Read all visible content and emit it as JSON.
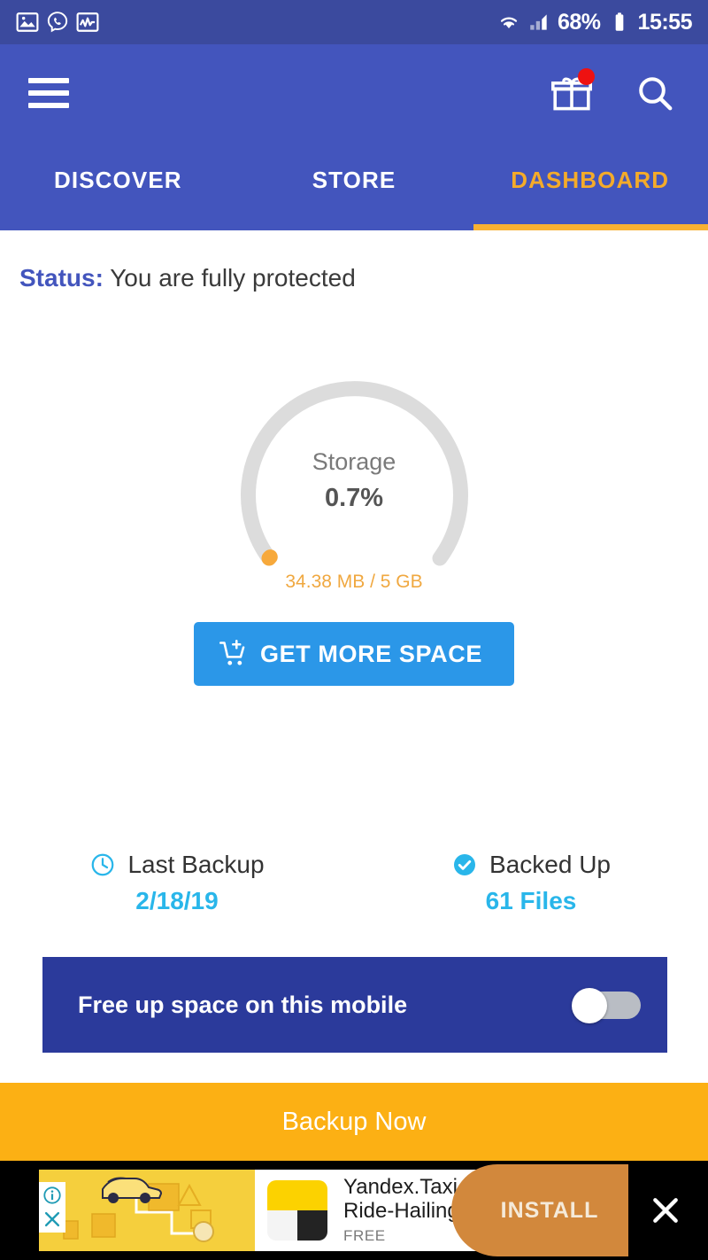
{
  "statusbar": {
    "icons_left": [
      "gallery-icon",
      "viber-call-icon",
      "activity-monitor-icon"
    ],
    "wifi_icon": "wifi-icon",
    "signal_icon": "cell-signal-icon",
    "battery_percent": "68%",
    "battery_icon": "battery-icon",
    "time": "15:55"
  },
  "appbar": {
    "menu_icon": "hamburger-menu-icon",
    "gift_icon": "gift-icon",
    "gift_badge": "",
    "search_icon": "search-icon",
    "tabs": [
      {
        "label": "DISCOVER",
        "active": false
      },
      {
        "label": "STORE",
        "active": false
      },
      {
        "label": "DASHBOARD",
        "active": true
      }
    ]
  },
  "status": {
    "label": "Status:",
    "value": "You are fully protected"
  },
  "gauge": {
    "title": "Storage",
    "percent_label": "0.7%",
    "usage_label": "34.38 MB / 5 GB",
    "percent_value": 0.7,
    "used": "34.38 MB",
    "total": "5 GB",
    "track_color": "#dcdcdc",
    "progress_color": "#f7a93b"
  },
  "cta": {
    "icon": "cart-plus-icon",
    "label": "GET MORE SPACE",
    "color": "#2b97e8"
  },
  "backup_info": [
    {
      "icon": "clock-icon",
      "title": "Last Backup",
      "value": "2/18/19"
    },
    {
      "icon": "check-circle-icon",
      "title": "Backed Up",
      "value": "61 Files"
    }
  ],
  "freeup": {
    "label": "Free up space on this mobile",
    "toggle_state": "off",
    "background": "#2b3a9b"
  },
  "backup_now": {
    "label": "Backup Now",
    "background": "#fcb014"
  },
  "ad": {
    "info_icon": "ad-info-icon",
    "dismiss_icon": "ad-dismiss-icon",
    "app_icon": "yandex-taxi-app-icon",
    "title_line1": "Yandex.Taxi",
    "title_line2": "Ride-Hailing S...",
    "price": "FREE",
    "install_label": "INSTALL",
    "close_icon": "close-icon"
  }
}
